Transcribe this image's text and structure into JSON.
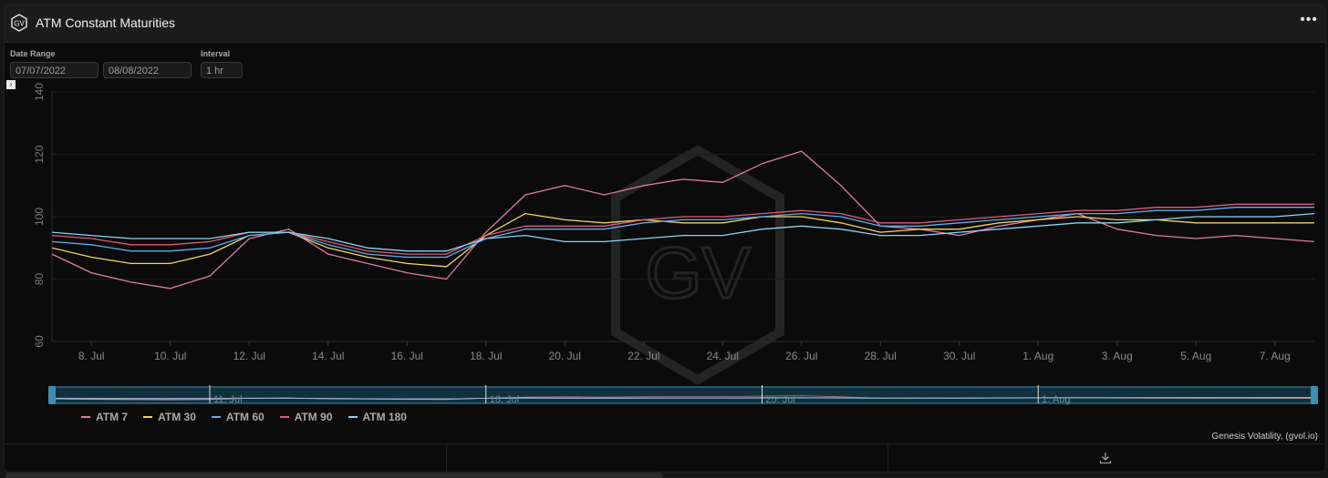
{
  "header": {
    "logo_text": "GV",
    "title": "ATM Constant Maturities",
    "menu_icon": "more-dots-icon"
  },
  "controls": {
    "date_range_label": "Date Range",
    "start_date": "07/07/2022",
    "end_date": "08/08/2022",
    "interval_label": "Interval",
    "interval": "1 hr"
  },
  "credits": "Genesis Volatility, (gvol.io)",
  "colors": {
    "background": "#0b0b0b",
    "header": "#1c1c1c",
    "grid": "#2a2a2a",
    "navigator_border": "#3a8fb3"
  },
  "chart_data": {
    "type": "line",
    "title": "",
    "xlabel": "",
    "ylabel": "",
    "ylim": [
      60,
      140
    ],
    "y_ticks": [
      60,
      80,
      100,
      120,
      140
    ],
    "xlim": [
      "2022-07-07",
      "2022-08-08"
    ],
    "x_ticks": [
      {
        "date": "2022-07-08",
        "label": "8. Jul"
      },
      {
        "date": "2022-07-10",
        "label": "10. Jul"
      },
      {
        "date": "2022-07-12",
        "label": "12. Jul"
      },
      {
        "date": "2022-07-14",
        "label": "14. Jul"
      },
      {
        "date": "2022-07-16",
        "label": "16. Jul"
      },
      {
        "date": "2022-07-18",
        "label": "18. Jul"
      },
      {
        "date": "2022-07-20",
        "label": "20. Jul"
      },
      {
        "date": "2022-07-22",
        "label": "22. Jul"
      },
      {
        "date": "2022-07-24",
        "label": "24. Jul"
      },
      {
        "date": "2022-07-26",
        "label": "26. Jul"
      },
      {
        "date": "2022-07-28",
        "label": "28. Jul"
      },
      {
        "date": "2022-07-30",
        "label": "30. Jul"
      },
      {
        "date": "2022-08-01",
        "label": "1. Aug"
      },
      {
        "date": "2022-08-03",
        "label": "3. Aug"
      },
      {
        "date": "2022-08-05",
        "label": "5. Aug"
      },
      {
        "date": "2022-08-07",
        "label": "7. Aug"
      }
    ],
    "navigator_ticks": [
      {
        "date": "2022-07-11",
        "label": "11. Jul"
      },
      {
        "date": "2022-07-18",
        "label": "18. Jul"
      },
      {
        "date": "2022-07-25",
        "label": "25. Jul"
      },
      {
        "date": "2022-08-01",
        "label": "1. Aug"
      }
    ],
    "grid": true,
    "legend_position": "bottom-left",
    "x": [
      "2022-07-07",
      "2022-07-08",
      "2022-07-09",
      "2022-07-10",
      "2022-07-11",
      "2022-07-12",
      "2022-07-13",
      "2022-07-14",
      "2022-07-15",
      "2022-07-16",
      "2022-07-17",
      "2022-07-18",
      "2022-07-19",
      "2022-07-20",
      "2022-07-21",
      "2022-07-22",
      "2022-07-23",
      "2022-07-24",
      "2022-07-25",
      "2022-07-26",
      "2022-07-27",
      "2022-07-28",
      "2022-07-29",
      "2022-07-30",
      "2022-07-31",
      "2022-08-01",
      "2022-08-02",
      "2022-08-03",
      "2022-08-04",
      "2022-08-05",
      "2022-08-06",
      "2022-08-07",
      "2022-08-08"
    ],
    "series": [
      {
        "name": "ATM 7",
        "color": "#e27aa6",
        "values": [
          88,
          82,
          79,
          77,
          81,
          93,
          96,
          88,
          85,
          82,
          80,
          95,
          107,
          110,
          107,
          110,
          112,
          111,
          117,
          121,
          110,
          97,
          96,
          94,
          97,
          99,
          101,
          96,
          94,
          93,
          94,
          93,
          92
        ]
      },
      {
        "name": "ATM 30",
        "color": "#f4d35e",
        "values": [
          90,
          87,
          85,
          85,
          88,
          94,
          95,
          90,
          87,
          85,
          84,
          94,
          101,
          99,
          98,
          99,
          98,
          98,
          100,
          100,
          98,
          95,
          96,
          96,
          98,
          99,
          100,
          99,
          99,
          98,
          98,
          98,
          98
        ]
      },
      {
        "name": "ATM 60",
        "color": "#5dadec",
        "values": [
          92,
          91,
          89,
          89,
          90,
          94,
          95,
          91,
          88,
          87,
          87,
          93,
          96,
          96,
          96,
          98,
          99,
          99,
          100,
          101,
          100,
          97,
          97,
          98,
          99,
          100,
          101,
          101,
          102,
          102,
          103,
          103,
          103
        ]
      },
      {
        "name": "ATM 90",
        "color": "#e05a7a",
        "values": [
          94,
          93,
          91,
          91,
          92,
          95,
          95,
          92,
          89,
          88,
          88,
          94,
          97,
          97,
          97,
          99,
          100,
          100,
          101,
          102,
          101,
          98,
          98,
          99,
          100,
          101,
          102,
          102,
          103,
          103,
          104,
          104,
          104
        ]
      },
      {
        "name": "ATM 180",
        "color": "#8ad3f7",
        "values": [
          95,
          94,
          93,
          93,
          93,
          95,
          95,
          93,
          90,
          89,
          89,
          93,
          94,
          92,
          92,
          93,
          94,
          94,
          96,
          97,
          96,
          94,
          94,
          95,
          96,
          97,
          98,
          98,
          99,
          100,
          100,
          100,
          101
        ]
      }
    ]
  }
}
